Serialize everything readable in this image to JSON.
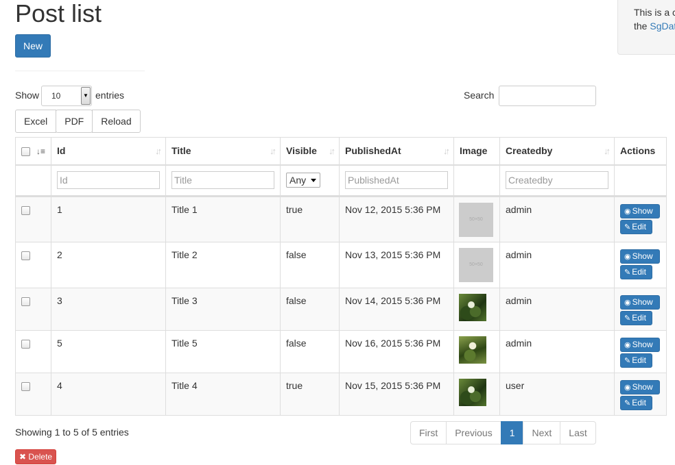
{
  "page": {
    "title": "Post list",
    "new_label": "New"
  },
  "info_box": {
    "text": "This is a c",
    "text2": "the ",
    "link": "SgDat"
  },
  "controls": {
    "show_label": "Show",
    "entries_label": "entries",
    "length_value": "10",
    "search_label": "Search",
    "buttons": [
      "Excel",
      "PDF",
      "Reload"
    ]
  },
  "table": {
    "headers": {
      "id": "Id",
      "title": "Title",
      "visible": "Visible",
      "published": "PublishedAt",
      "image": "Image",
      "createdby": "Createdby",
      "actions": "Actions"
    },
    "filters": {
      "id": "Id",
      "title": "Title",
      "visible": "Any",
      "published": "PublishedAt",
      "createdby": "Createdby"
    },
    "rows": [
      {
        "id": "1",
        "title": "Title 1",
        "visible": "true",
        "published": "Nov 12, 2015 5:36 PM",
        "createdby": "admin",
        "image": "placeholder-image"
      },
      {
        "id": "2",
        "title": "Title 2",
        "visible": "false",
        "published": "Nov 13, 2015 5:36 PM",
        "createdby": "admin",
        "image": "placeholder-image"
      },
      {
        "id": "3",
        "title": "Title 3",
        "visible": "false",
        "published": "Nov 14, 2015 5:36 PM",
        "createdby": "admin",
        "image": "flower-photo"
      },
      {
        "id": "5",
        "title": "Title 5",
        "visible": "false",
        "published": "Nov 16, 2015 5:36 PM",
        "createdby": "admin",
        "image": "flower-photo"
      },
      {
        "id": "4",
        "title": "Title 4",
        "visible": "true",
        "published": "Nov 15, 2015 5:36 PM",
        "createdby": "user",
        "image": "flower-photo"
      }
    ],
    "show_label": "Show",
    "edit_label": "Edit"
  },
  "footer": {
    "info": "Showing 1 to 5 of 5 entries",
    "pagination": {
      "first": "First",
      "previous": "Previous",
      "current": "1",
      "next": "Next",
      "last": "Last"
    },
    "delete_label": "Delete"
  },
  "colors": {
    "primary": "#337ab7",
    "danger": "#d9534f"
  }
}
